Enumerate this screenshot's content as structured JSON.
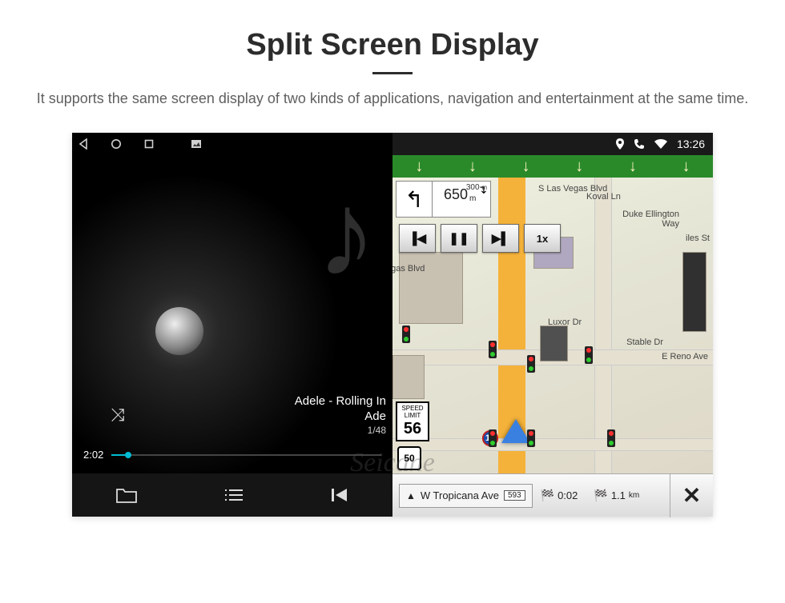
{
  "page": {
    "title": "Split Screen Display",
    "subtitle": "It supports the same screen display of two kinds of applications, navigation and entertainment at the same time."
  },
  "status": {
    "time": "13:26"
  },
  "player": {
    "track_title": "Adele - Rolling In",
    "artist": "Ade",
    "counter": "1/48",
    "elapsed": "2:02"
  },
  "nav": {
    "instruction_main_distance": "650",
    "instruction_main_unit": "m",
    "instruction_secondary_distance": "300",
    "instruction_secondary_unit": "m",
    "speed_label_l1": "SPEED",
    "speed_label_l2": "LIMIT",
    "speed_limit": "56",
    "route_number": "50",
    "interstate": "15",
    "speed_rate": "1x",
    "eta_time": "0:02",
    "eta_distance": "1.1",
    "eta_distance_unit": "km",
    "street_current": "W Tropicana Ave",
    "street_number": "593",
    "street_top": "S Las Vegas Blvd",
    "street_vegas": "egas Blvd",
    "street_koval": "Koval Ln",
    "street_duke_1": "Duke Ellington",
    "street_duke_2": "Way",
    "street_luxor": "Luxor Dr",
    "street_stable": "Stable Dr",
    "street_reno": "E Reno Ave",
    "street_giles": "iles St"
  },
  "watermark": "Seicane"
}
